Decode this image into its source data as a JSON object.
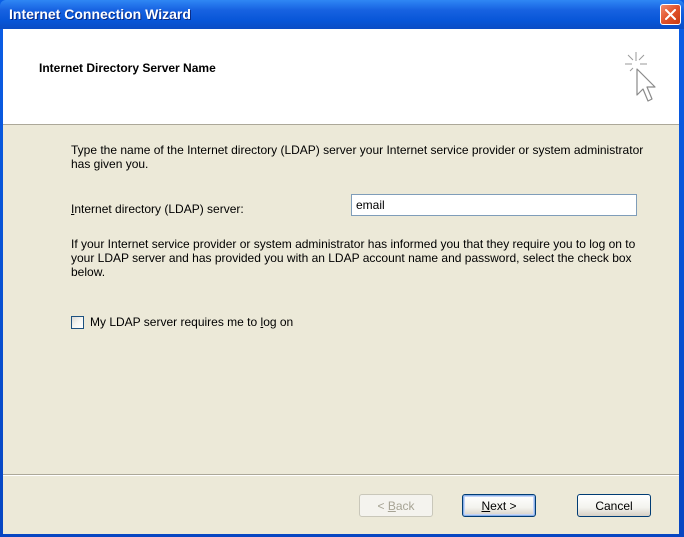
{
  "window": {
    "title": "Internet Connection Wizard"
  },
  "header": {
    "title": "Internet Directory Server Name",
    "icon": "wizard-cursor-sparkle-icon"
  },
  "body": {
    "intro": "Type the name of the Internet directory (LDAP) server your Internet service provider or system administrator has given you.",
    "server_label": "Internet directory (LDAP) server:",
    "server_value": "email",
    "logon_info": "If your Internet service provider or system administrator has informed you that they require you to log on to your LDAP server and has provided you with an LDAP account name and password, select the check box below.",
    "logon_checkbox_label": "My LDAP server requires me to log on",
    "logon_checked": false
  },
  "buttons": {
    "back": "< Back",
    "next": "Next >",
    "cancel": "Cancel"
  },
  "colors": {
    "titlebar": "#0856d8",
    "dialog_bg": "#ece9d8",
    "close_button": "#e2522a"
  }
}
